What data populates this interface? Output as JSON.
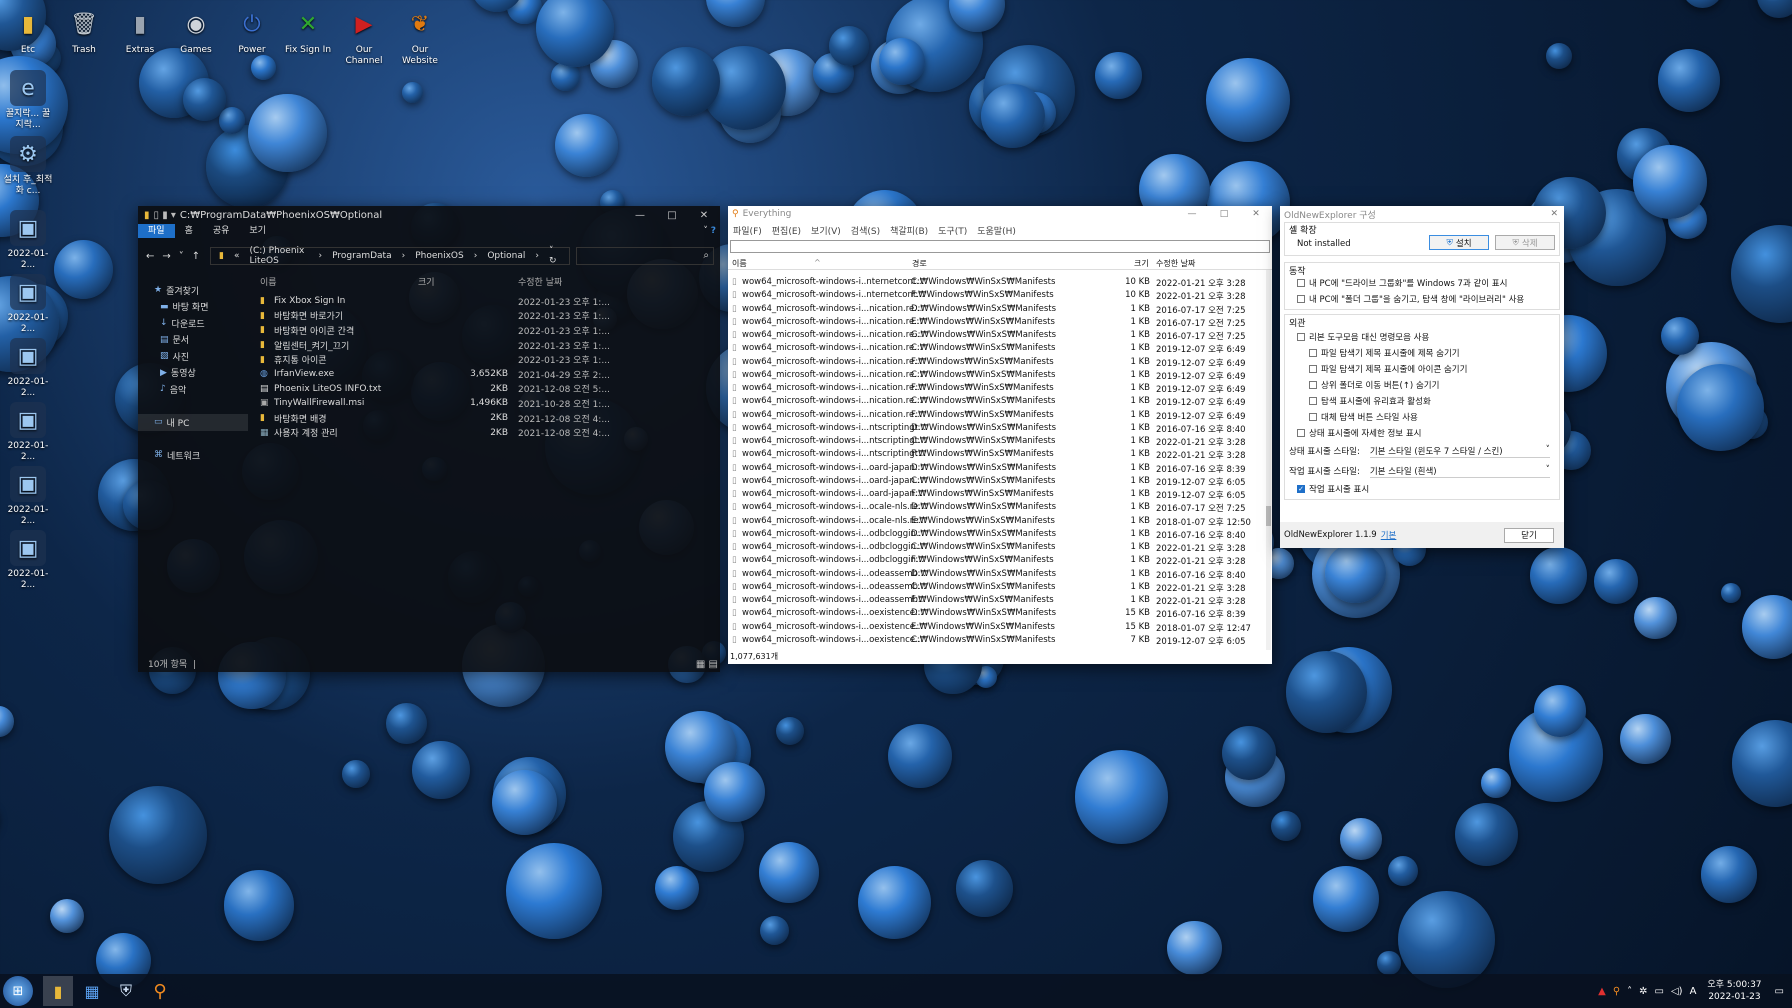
{
  "desktop": {
    "icons": [
      {
        "label": "Etc",
        "icon": "folder-icon",
        "color": "#e8b83a"
      },
      {
        "label": "Trash",
        "icon": "trash-icon",
        "color": "#bcc4cc"
      },
      {
        "label": "Extras",
        "icon": "folder-icon",
        "color": "#9aa4b0"
      },
      {
        "label": "Games",
        "icon": "gamepad-icon",
        "color": "#cfd4da"
      },
      {
        "label": "Power",
        "icon": "power-icon",
        "color": "#3a6fd0"
      },
      {
        "label": "Fix Sign In",
        "icon": "xbox-icon",
        "color": "#2fa82f"
      },
      {
        "label": "Our Channel",
        "icon": "youtube-icon",
        "color": "#d02020"
      },
      {
        "label": "Our Website",
        "icon": "phoenix-icon",
        "color": "#e07a10"
      }
    ],
    "side": [
      {
        "label": "꿀지락... 꿀지락...",
        "icon": "ie-icon"
      },
      {
        "label": "설치 후_최적화 c...",
        "icon": "settings-icon"
      },
      {
        "label": "2022-01-2...",
        "icon": "screenshot-icon"
      },
      {
        "label": "2022-01-2...",
        "icon": "screenshot-icon"
      },
      {
        "label": "2022-01-2...",
        "icon": "screenshot-icon"
      },
      {
        "label": "2022-01-2...",
        "icon": "screenshot-icon"
      },
      {
        "label": "2022-01-2...",
        "icon": "screenshot-icon"
      },
      {
        "label": "2022-01-2...",
        "icon": "screenshot-icon"
      }
    ]
  },
  "explorer": {
    "title": "C:₩ProgramData₩PhoenixOS₩Optional",
    "tabs": [
      "파일",
      "홈",
      "공유",
      "보기"
    ],
    "path": [
      "(C:) Phoenix LiteOS",
      "ProgramData",
      "PhoenixOS",
      "Optional"
    ],
    "nav": [
      {
        "label": "즐겨찾기",
        "icon": "star-icon"
      },
      {
        "label": "바탕 화면",
        "icon": "desktop-icon"
      },
      {
        "label": "다운로드",
        "icon": "download-icon"
      },
      {
        "label": "문서",
        "icon": "document-icon"
      },
      {
        "label": "사진",
        "icon": "picture-icon"
      },
      {
        "label": "동영상",
        "icon": "video-icon"
      },
      {
        "label": "음악",
        "icon": "music-icon"
      },
      {
        "label": "",
        "icon": ""
      },
      {
        "label": "내 PC",
        "icon": "pc-icon"
      },
      {
        "label": "",
        "icon": ""
      },
      {
        "label": "네트워크",
        "icon": "network-icon"
      }
    ],
    "columns": [
      "이름",
      "크기",
      "수정한 날짜"
    ],
    "files": [
      {
        "name": "Fix Xbox Sign In",
        "size": "",
        "date": "2022-01-23 오후 1:...",
        "icon": "folder"
      },
      {
        "name": "바탕화면 바로가기",
        "size": "",
        "date": "2022-01-23 오후 1:...",
        "icon": "folder"
      },
      {
        "name": "바탕화면 아이콘 간격",
        "size": "",
        "date": "2022-01-23 오후 1:...",
        "icon": "folder"
      },
      {
        "name": "알림센터_켜기_끄기",
        "size": "",
        "date": "2022-01-23 오후 1:...",
        "icon": "folder"
      },
      {
        "name": "휴지통 아이콘",
        "size": "",
        "date": "2022-01-23 오후 1:...",
        "icon": "folder"
      },
      {
        "name": "IrfanView.exe",
        "size": "3,652KB",
        "date": "2021-04-29 오후 2:...",
        "icon": "exe"
      },
      {
        "name": "Phoenix LiteOS INFO.txt",
        "size": "2KB",
        "date": "2021-12-08 오전 5:...",
        "icon": "txt"
      },
      {
        "name": "TinyWallFirewall.msi",
        "size": "1,496KB",
        "date": "2021-10-28 오전 1:...",
        "icon": "msi"
      },
      {
        "name": "바탕화면 배경",
        "size": "2KB",
        "date": "2021-12-08 오전 4:...",
        "icon": "folder"
      },
      {
        "name": "사용자 계정 관리",
        "size": "2KB",
        "date": "2021-12-08 오전 4:...",
        "icon": "reg"
      }
    ],
    "status": "10개 항목"
  },
  "everything": {
    "title": "Everything",
    "menu": [
      "파일(F)",
      "편집(E)",
      "보기(V)",
      "검색(S)",
      "책갈피(B)",
      "도구(T)",
      "도움말(H)"
    ],
    "columns": [
      "이름",
      "경로",
      "크기",
      "수정한 날짜"
    ],
    "rows": [
      [
        "wow64_microsoft-windows-i..nternetcont...",
        "C:₩Windows₩WinSxS₩Manifests",
        "10 KB",
        "2022-01-21 오후 3:28"
      ],
      [
        "wow64_microsoft-windows-i..nternetcont...",
        "F:₩Windows₩WinSxS₩Manifests",
        "10 KB",
        "2022-01-21 오후 3:28"
      ],
      [
        "wow64_microsoft-windows-i...nication.re...",
        "D:₩Windows₩WinSxS₩Manifests",
        "1 KB",
        "2016-07-17 오전 7:25"
      ],
      [
        "wow64_microsoft-windows-i...nication.re...",
        "E:₩Windows₩WinSxS₩Manifests",
        "1 KB",
        "2016-07-17 오전 7:25"
      ],
      [
        "wow64_microsoft-windows-i...nication.re...",
        "G:₩Windows₩WinSxS₩Manifests",
        "1 KB",
        "2016-07-17 오전 7:25"
      ],
      [
        "wow64_microsoft-windows-i...nication.re...",
        "C:₩Windows₩WinSxS₩Manifests",
        "1 KB",
        "2019-12-07 오후 6:49"
      ],
      [
        "wow64_microsoft-windows-i...nication.re...",
        "F:₩Windows₩WinSxS₩Manifests",
        "1 KB",
        "2019-12-07 오후 6:49"
      ],
      [
        "wow64_microsoft-windows-i...nication.re...",
        "C:₩Windows₩WinSxS₩Manifests",
        "1 KB",
        "2019-12-07 오후 6:49"
      ],
      [
        "wow64_microsoft-windows-i...nication.re...",
        "F:₩Windows₩WinSxS₩Manifests",
        "1 KB",
        "2019-12-07 오후 6:49"
      ],
      [
        "wow64_microsoft-windows-i...nication.re...",
        "C:₩Windows₩WinSxS₩Manifests",
        "1 KB",
        "2019-12-07 오후 6:49"
      ],
      [
        "wow64_microsoft-windows-i...nication.re...",
        "F:₩Windows₩WinSxS₩Manifests",
        "1 KB",
        "2019-12-07 오후 6:49"
      ],
      [
        "wow64_microsoft-windows-i...ntscriptingt...",
        "D:₩Windows₩WinSxS₩Manifests",
        "1 KB",
        "2016-07-16 오후 8:40"
      ],
      [
        "wow64_microsoft-windows-i...ntscriptingt...",
        "C:₩Windows₩WinSxS₩Manifests",
        "1 KB",
        "2022-01-21 오후 3:28"
      ],
      [
        "wow64_microsoft-windows-i...ntscriptingt...",
        "F:₩Windows₩WinSxS₩Manifests",
        "1 KB",
        "2022-01-21 오후 3:28"
      ],
      [
        "wow64_microsoft-windows-i...oard-japan...",
        "D:₩Windows₩WinSxS₩Manifests",
        "1 KB",
        "2016-07-16 오후 8:39"
      ],
      [
        "wow64_microsoft-windows-i...oard-japan...",
        "C:₩Windows₩WinSxS₩Manifests",
        "1 KB",
        "2019-12-07 오후 6:05"
      ],
      [
        "wow64_microsoft-windows-i...oard-japan...",
        "F:₩Windows₩WinSxS₩Manifests",
        "1 KB",
        "2019-12-07 오후 6:05"
      ],
      [
        "wow64_microsoft-windows-i...ocale-nls.re...",
        "D:₩Windows₩WinSxS₩Manifests",
        "1 KB",
        "2016-07-17 오전 7:25"
      ],
      [
        "wow64_microsoft-windows-i...ocale-nls.re...",
        "E:₩Windows₩WinSxS₩Manifests",
        "1 KB",
        "2018-01-07 오후 12:50"
      ],
      [
        "wow64_microsoft-windows-i...odbcloggin...",
        "D:₩Windows₩WinSxS₩Manifests",
        "1 KB",
        "2016-07-16 오후 8:40"
      ],
      [
        "wow64_microsoft-windows-i...odbcloggin...",
        "C:₩Windows₩WinSxS₩Manifests",
        "1 KB",
        "2022-01-21 오후 3:28"
      ],
      [
        "wow64_microsoft-windows-i...odbcloggin...",
        "F:₩Windows₩WinSxS₩Manifests",
        "1 KB",
        "2022-01-21 오후 3:28"
      ],
      [
        "wow64_microsoft-windows-i...odeassemb...",
        "D:₩Windows₩WinSxS₩Manifests",
        "1 KB",
        "2016-07-16 오후 8:40"
      ],
      [
        "wow64_microsoft-windows-i...odeassemb...",
        "C:₩Windows₩WinSxS₩Manifests",
        "1 KB",
        "2022-01-21 오후 3:28"
      ],
      [
        "wow64_microsoft-windows-i...odeassemb...",
        "F:₩Windows₩WinSxS₩Manifests",
        "1 KB",
        "2022-01-21 오후 3:28"
      ],
      [
        "wow64_microsoft-windows-i...oexistence...",
        "D:₩Windows₩WinSxS₩Manifests",
        "15 KB",
        "2016-07-16 오후 8:39"
      ],
      [
        "wow64_microsoft-windows-i...oexistence...",
        "E:₩Windows₩WinSxS₩Manifests",
        "15 KB",
        "2018-01-07 오후 12:47"
      ],
      [
        "wow64_microsoft-windows-i...oexistence...",
        "C:₩Windows₩WinSxS₩Manifests",
        "7 KB",
        "2019-12-07 오후 6:05"
      ]
    ],
    "status": "1,077,631개"
  },
  "one": {
    "title": "OldNewExplorer 구성",
    "g1": "셸 확장",
    "not_installed": "Not installed",
    "install": "설치",
    "uninstall": "삭제",
    "g2": "동작",
    "b1": "내 PC에 \"드라이브 그룹화\"를 Windows 7과 같이 표시",
    "b2": "내 PC에 \"폴더 그룹\"을 숨기고, 탐색 창에 \"라이브러리\" 사용",
    "g3": "외관",
    "a1": "리본 도구모음 대신 명령모음 사용",
    "a2": "파일 탐색기 제목 표시줄에 제목 숨기기",
    "a3": "파일 탐색기 제목 표시줄에 아이콘 숨기기",
    "a4": "상위 폴더로 이동 버튼(↑) 숨기기",
    "a5": "탐색 표시줄에 유리효과 활성화",
    "a6": "대체 탐색 버튼 스타일 사용",
    "a7": "상태 표시줄에 자세한 정보 표시",
    "s1l": "상태 표시줄 스타일:",
    "s1v": "기본 스타일 (윈도우 7 스타일 / 스킨)",
    "s2l": "작업 표시줄 스타일:",
    "s2v": "기본 스타일 (흰색)",
    "c1": "작업 표시줄 표시",
    "ver": "OldNewExplorer 1.1.9",
    "link": "기본",
    "close": "닫기"
  },
  "taskbar": {
    "time": "오후 5:00:37",
    "date": "2022-01-23",
    "ime": "A"
  }
}
